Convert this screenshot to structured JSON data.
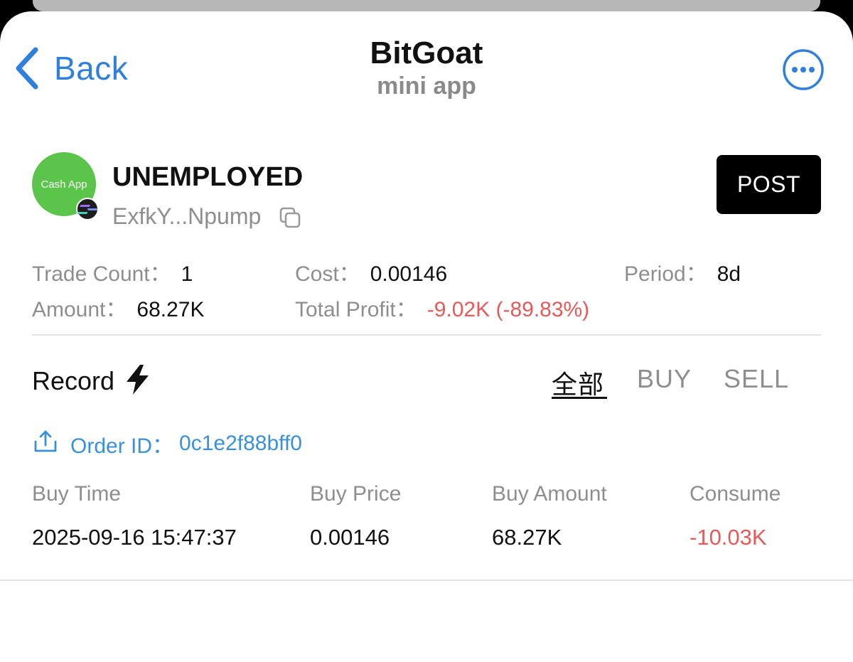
{
  "header": {
    "back_label": "Back",
    "title": "BitGoat",
    "subtitle": "mini app"
  },
  "token": {
    "avatar_text": "Cash App",
    "name": "UNEMPLOYED",
    "address": "ExfkY...Npump",
    "post_label": "POST"
  },
  "stats": {
    "trade_count_label": "Trade Count：",
    "trade_count": "1",
    "cost_label": "Cost：",
    "cost": "0.00146",
    "period_label": "Period：",
    "period": "8d",
    "amount_label": "Amount：",
    "amount": "68.27K",
    "total_profit_label": "Total Profit：",
    "total_profit": "-9.02K (-89.83%)"
  },
  "record": {
    "label": "Record",
    "tabs": [
      "全部",
      "BUY",
      "SELL"
    ],
    "active_tab": "全部"
  },
  "order": {
    "label": "Order ID：",
    "id": "0c1e2f88bff0"
  },
  "table": {
    "headers": [
      "Buy Time",
      "Buy Price",
      "Buy Amount",
      "Consume"
    ],
    "rows": [
      [
        "2025-09-16 15:47:37",
        "0.00146",
        "68.27K",
        "-10.03K"
      ]
    ]
  },
  "colors": {
    "accent_blue": "#2f7fdb",
    "negative_red": "#e55a5a",
    "avatar_green": "#5ac54a"
  },
  "icons": [
    "chevron-left-icon",
    "more-options-icon",
    "solana-icon",
    "copy-icon",
    "lightning-icon",
    "share-upload-icon"
  ]
}
